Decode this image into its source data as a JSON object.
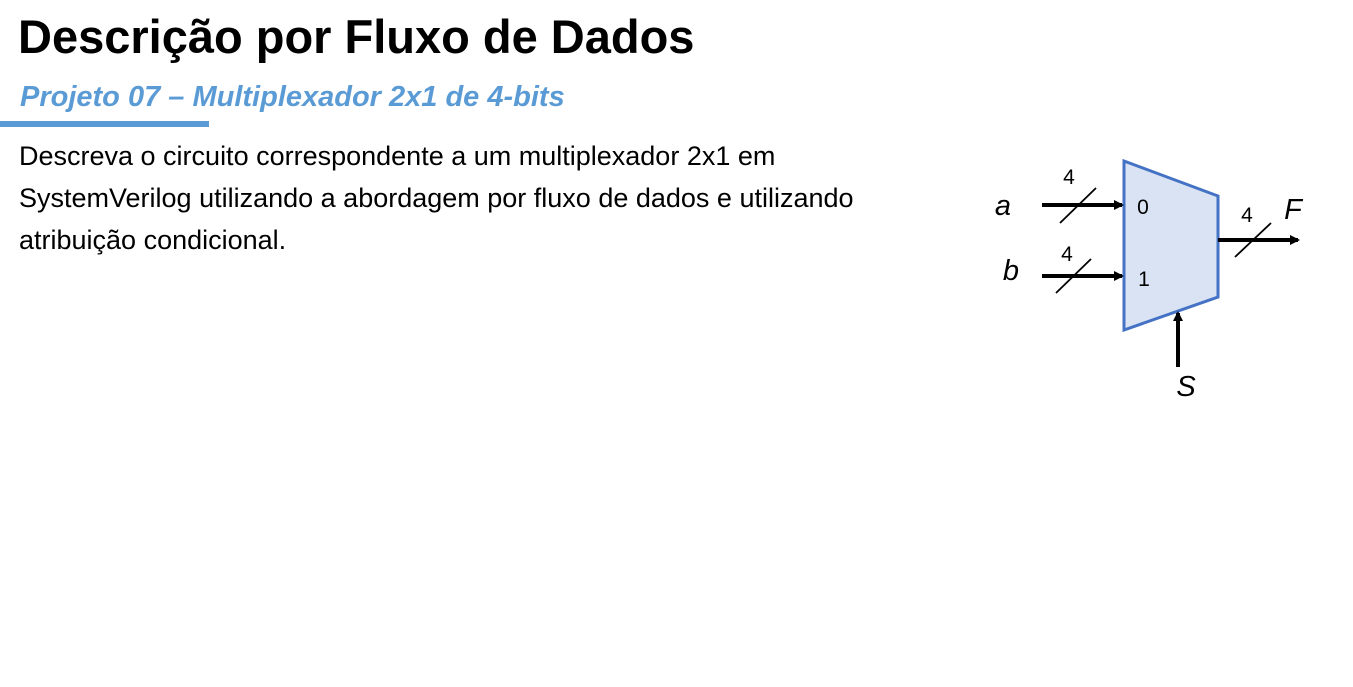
{
  "slide": {
    "title": "Descrição por Fluxo de Dados",
    "subtitle": "Projeto 07 – Multiplexador 2x1 de 4-bits",
    "body": "Descreva o circuito correspondente a um multiplexador 2x1 em SystemVerilog utilizando a abordagem por fluxo de dados e utilizando atribuição condicional.",
    "accent_color": "#5B9BD5"
  },
  "diagram": {
    "component": "mux",
    "input_a": {
      "name": "a",
      "width": "4",
      "port": "0"
    },
    "input_b": {
      "name": "b",
      "width": "4",
      "port": "1"
    },
    "output": {
      "name": "F",
      "width": "4"
    },
    "select": {
      "name": "S"
    },
    "fill_color": "#DAE3F3",
    "stroke_color": "#4472C4"
  }
}
